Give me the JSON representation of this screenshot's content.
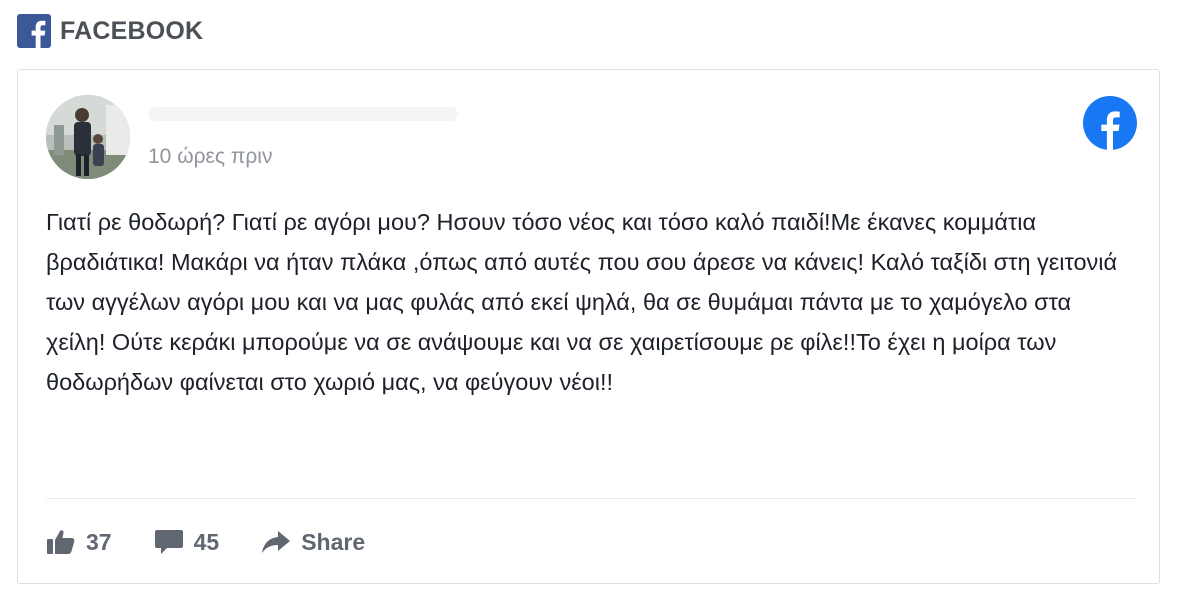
{
  "source": {
    "label": "FACEBOOK",
    "brand_color": "#3b5998",
    "icon": "facebook-square-icon"
  },
  "post": {
    "timestamp": "10 ώρες πριν",
    "text": "Γιατί ρε θοδωρή? Γιατί ρε αγόρι μου? Ησουν τόσο νέος και τόσο καλό παιδί!Με έκανες κομμάτια βραδιάτικα! Μακάρι να ήταν πλάκα ,όπως από αυτές που σου άρεσε να κάνεις! Καλό ταξίδι στη γειτονιά των αγγέλων αγόρι μου και να μας φυλάς από εκεί ψηλά, θα σε θυμάμαι πάντα με το χαμόγελο στα χείλη! Ούτε κεράκι μπορούμε να σε ανάψουμε και να σε χαιρετίσουμε ρε φίλε!!Το έχει η μοίρα των θοδωρήδων φαίνεται στο χωριό μας, να φεύγουν νέοι!!",
    "brand_icon": "facebook-circle-icon",
    "brand_icon_color": "#1877f2",
    "actions": {
      "likes": "37",
      "comments": "45",
      "share_label": "Share"
    }
  }
}
